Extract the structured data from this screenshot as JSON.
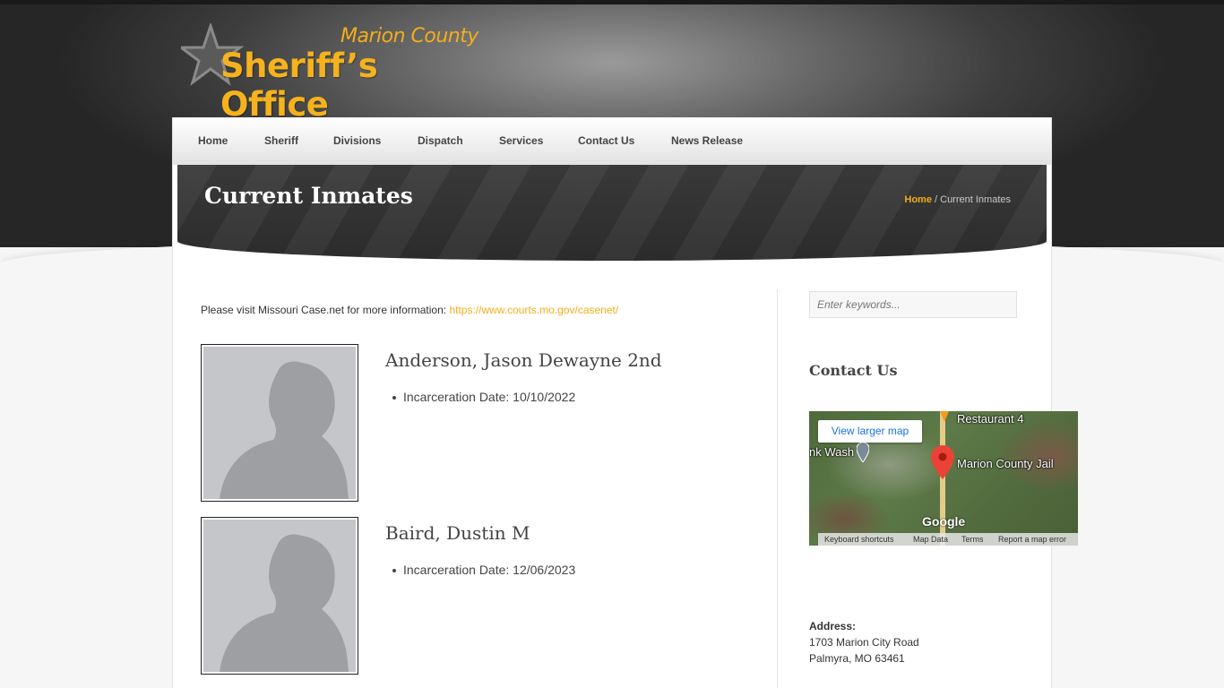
{
  "logo": {
    "line1": "Marion County",
    "line2": "Sheriff’s Office"
  },
  "nav": {
    "items": [
      {
        "label": "Home"
      },
      {
        "label": "Sheriff"
      },
      {
        "label": "Divisions"
      },
      {
        "label": "Dispatch"
      },
      {
        "label": "Services"
      },
      {
        "label": "Contact Us"
      },
      {
        "label": "News Release"
      }
    ]
  },
  "page": {
    "title": "Current Inmates",
    "breadcrumb": {
      "home": "Home",
      "separator": " / ",
      "current": "Current Inmates"
    }
  },
  "intro": {
    "text": "Please visit Missouri Case.net for more information: ",
    "link": "https://www.courts.mo.gov/casenet/"
  },
  "inmates": [
    {
      "name": "Anderson, Jason Dewayne 2nd",
      "detail": "Incarceration Date: 10/10/2022"
    },
    {
      "name": "Baird, Dustin M",
      "detail": "Incarceration Date: 12/06/2023"
    }
  ],
  "sidebar": {
    "search_placeholder": "Enter keywords...",
    "contact_heading": "Contact Us",
    "map": {
      "button": "View larger map",
      "labels": {
        "restaurant": "Restaurant 4",
        "wash": "nk Wash",
        "jail": "Marion County Jail"
      },
      "logo": "Google",
      "footer": [
        "Keyboard shortcuts",
        "Map Data",
        "Terms",
        "Report a map error"
      ]
    },
    "address": {
      "label": "Address:",
      "line1": "1703 Marion City Road",
      "line2": "Palmyra, MO 63461"
    }
  },
  "colors": {
    "accent": "#f3ae1a",
    "header_dark": "#2e2e2e",
    "text": "#444444"
  }
}
